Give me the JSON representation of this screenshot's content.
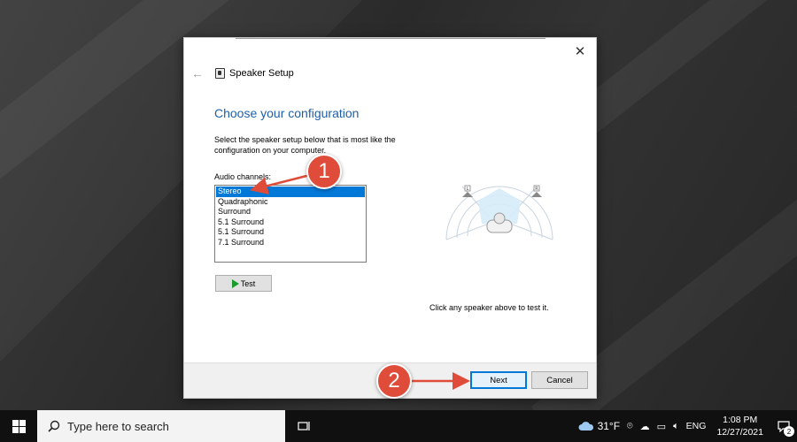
{
  "dialog": {
    "title": "Speaker Setup",
    "heading": "Choose your configuration",
    "description": "Select the speaker setup below that is most like the configuration on your computer.",
    "channels_label": "Audio channels:",
    "channels": [
      {
        "label": "Stereo",
        "selected": true
      },
      {
        "label": "Quadraphonic",
        "selected": false
      },
      {
        "label": "Surround",
        "selected": false
      },
      {
        "label": "5.1 Surround",
        "selected": false
      },
      {
        "label": "5.1 Surround",
        "selected": false
      },
      {
        "label": "7.1 Surround",
        "selected": false
      }
    ],
    "test_label": "Test",
    "hint": "Click any speaker above to test it.",
    "speaker_left_label": "L",
    "speaker_right_label": "R",
    "next_label": "Next",
    "cancel_label": "Cancel",
    "close_glyph": "✕",
    "back_glyph": "←"
  },
  "annotations": {
    "step1": "1",
    "step2": "2",
    "color": "#e04c3a"
  },
  "taskbar": {
    "search_placeholder": "Type here to search",
    "weather": "31°F",
    "language": "ENG",
    "time": "1:08 PM",
    "date": "12/27/2021",
    "notification_count": "2"
  },
  "colors": {
    "accent": "#0078d7",
    "heading": "#1f5fa8"
  }
}
